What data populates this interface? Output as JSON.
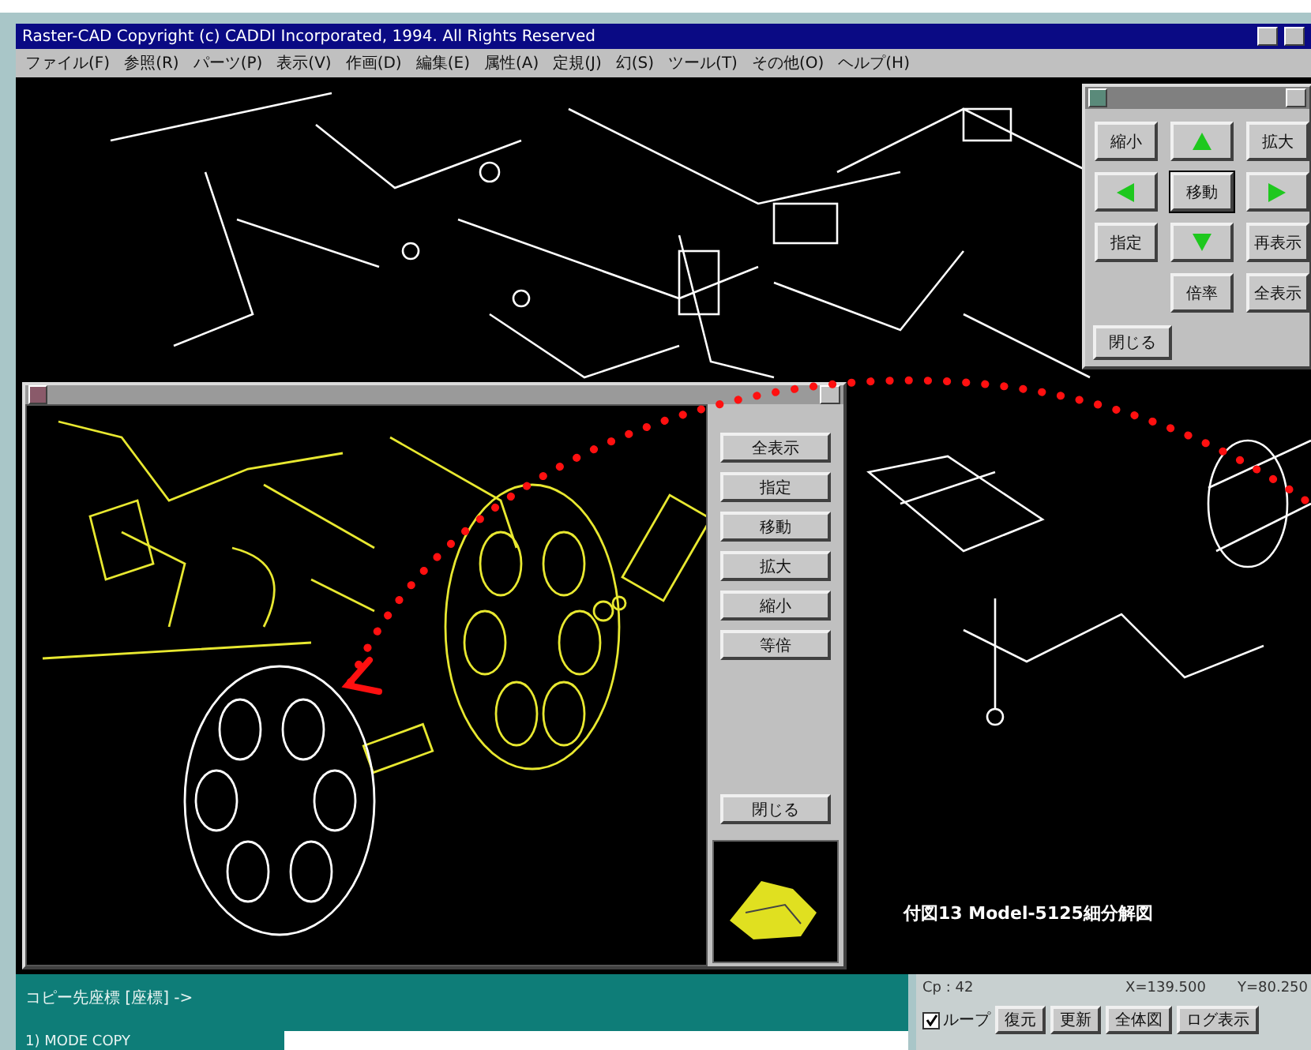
{
  "window": {
    "title": "Raster-CAD Copyright (c) CADDI Incorporated, 1994. All Rights Reserved"
  },
  "menu": [
    "ファイル(F)",
    "参照(R)",
    "パーツ(P)",
    "表示(V)",
    "作画(D)",
    "編集(E)",
    "属性(A)",
    "定規(J)",
    "幻(S)",
    "ツール(T)",
    "その他(O)",
    "ヘルプ(H)"
  ],
  "canvas": {
    "caption": "付図13 Model-5125細分解図"
  },
  "navigator": {
    "buttons": [
      {
        "kind": "text",
        "label": "縮小"
      },
      {
        "kind": "up"
      },
      {
        "kind": "text",
        "label": "拡大"
      },
      {
        "kind": "left"
      },
      {
        "kind": "text",
        "label": "移動",
        "default": true
      },
      {
        "kind": "right"
      },
      {
        "kind": "text",
        "label": "指定"
      },
      {
        "kind": "down"
      },
      {
        "kind": "text",
        "label": "再表示"
      },
      {
        "kind": "blank"
      },
      {
        "kind": "text",
        "label": "倍率"
      },
      {
        "kind": "text",
        "label": "全表示"
      }
    ],
    "close_button": "閉じる"
  },
  "detail_window": {
    "buttons": [
      "全表示",
      "指定",
      "移動",
      "拡大",
      "縮小",
      "等倍"
    ],
    "close_button": "閉じる"
  },
  "status": {
    "prompt": "コピー先座標 [座標] ->",
    "mode": "1) MODE COPY",
    "count": "Cp : 42",
    "x": "X=139.500",
    "y": "Y=80.250",
    "loop": {
      "label": "ループ",
      "checked": true
    },
    "buttons": [
      "復元",
      "更新",
      "全体図",
      "ログ表示"
    ]
  }
}
